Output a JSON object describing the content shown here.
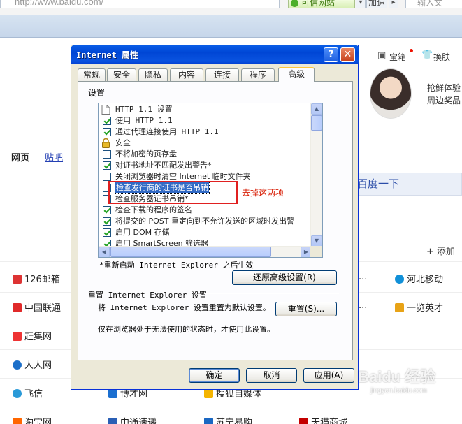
{
  "browser": {
    "url": "http://www.baidu.com/",
    "trust_label": "可信网站",
    "speed_label": "加速",
    "search_placeholder": "输入文"
  },
  "page": {
    "top_links": [
      "宝箱",
      "换肤"
    ],
    "promo_lines": [
      "抢鲜体验",
      "周边奖品"
    ],
    "nav": {
      "web": "网页",
      "tieba": "贴吧"
    },
    "search_button": "百度一下",
    "add_label": "+ 添加",
    "sites_left": [
      {
        "label": "126邮箱",
        "icon": "网易"
      },
      {
        "label": "中国联通",
        "icon": "联"
      },
      {
        "label": "赶集网",
        "icon": "赶"
      },
      {
        "label": "人人网",
        "icon": "人"
      },
      {
        "label": "飞信",
        "icon": "飞"
      },
      {
        "label": "淘宝网",
        "icon": "淘"
      }
    ],
    "sites_mid": [
      "博才网",
      "中通速递"
    ],
    "sites_mid2": [
      "搜狐自媒体",
      "苏宁易购"
    ],
    "sites_right": [
      "河北移动",
      "一览英才",
      "天猫商城"
    ],
    "ellipsis": "..."
  },
  "dialog": {
    "title": "Internet 属性",
    "help_button": "?",
    "close_button": "✕",
    "tabs": [
      "常规",
      "安全",
      "隐私",
      "内容",
      "连接",
      "程序",
      "高级"
    ],
    "active_tab": "高级",
    "settings_label": "设置",
    "list_items": [
      {
        "text": "HTTP 1.1 设置",
        "type": "header"
      },
      {
        "text": "使用 HTTP 1.1",
        "type": "check",
        "checked": true
      },
      {
        "text": "通过代理连接使用 HTTP 1.1",
        "type": "check",
        "checked": true
      },
      {
        "text": "安全",
        "type": "header"
      },
      {
        "text": "不将加密的页存盘",
        "type": "check",
        "checked": false
      },
      {
        "text": "对证书地址不匹配发出警告*",
        "type": "check",
        "checked": true
      },
      {
        "text": "关闭浏览器时清空 Internet 临时文件夹",
        "type": "check",
        "checked": false
      },
      {
        "text": "检查发行商的证书是否吊销",
        "type": "check",
        "checked": false,
        "selected": true
      },
      {
        "text": "检查服务器证书吊销*",
        "type": "check",
        "checked": false
      },
      {
        "text": "检查下载的程序的签名",
        "type": "check",
        "checked": true
      },
      {
        "text": "将提交的 POST 重定向到不允许发送的区域时发出警",
        "type": "check",
        "checked": true
      },
      {
        "text": "启用 DOM 存储",
        "type": "check",
        "checked": true
      },
      {
        "text": "启用 SmartScreen 筛选器",
        "type": "check",
        "checked": true
      }
    ],
    "restart_note": "*重新启动 Internet Explorer 之后生效",
    "restore_button": "还原高级设置(R)",
    "reset_group_title": "重置 Internet Explorer 设置",
    "reset_desc": "将 Internet Explorer 设置重置为默认设置。",
    "reset_button": "重置(S)...",
    "reset_note": "仅在浏览器处于无法使用的状态时，才使用此设置。",
    "ok_button": "确定",
    "cancel_button": "取消",
    "apply_button": "应用(A)"
  },
  "annotation": {
    "text": "去掉这两项",
    "color": "#e02020"
  },
  "watermark": {
    "main": "Baidu 经验",
    "sub": "jingyan.baidu.com"
  }
}
